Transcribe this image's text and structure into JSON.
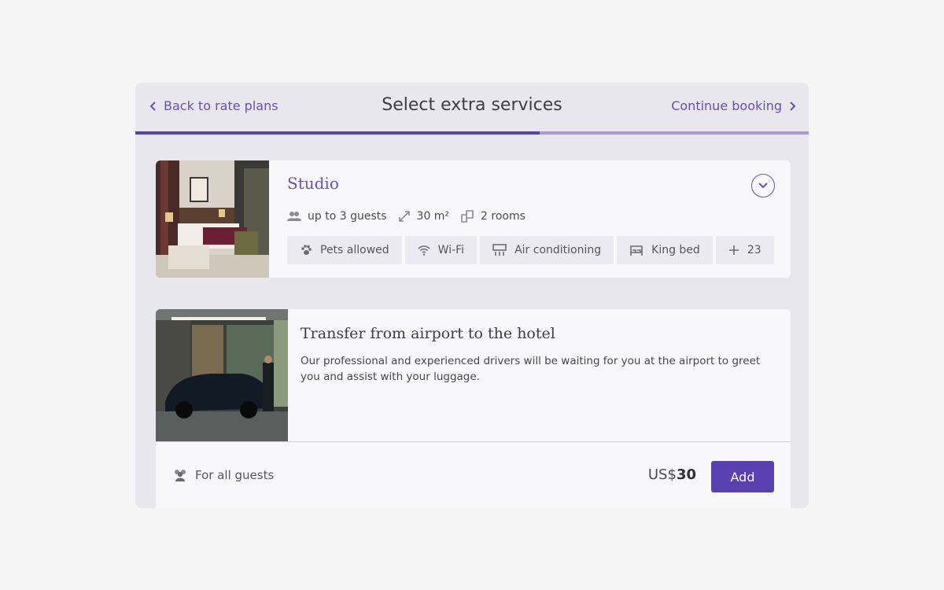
{
  "header": {
    "back_label": "Back to rate plans",
    "title": "Select extra services",
    "forward_label": "Continue booking",
    "progress_fraction": 0.6
  },
  "room": {
    "name": "Studio",
    "guests": "up to 3 guests",
    "area": "30 m²",
    "rooms": "2 rooms",
    "amenities": [
      {
        "icon": "paw-icon",
        "label": "Pets allowed"
      },
      {
        "icon": "wifi-icon",
        "label": "Wi-Fi"
      },
      {
        "icon": "air-conditioning-icon",
        "label": "Air conditioning"
      },
      {
        "icon": "bed-icon",
        "label": "King bed"
      },
      {
        "icon": "plus-icon",
        "label": "23"
      }
    ]
  },
  "service": {
    "title": "Transfer from airport to the hotel",
    "description": "Our professional and experienced drivers will be waiting for you at the airport to greet you and assist with your luggage.",
    "guests_label": "For all guests",
    "currency": "US$",
    "price": "30",
    "add_label": "Add"
  },
  "colors": {
    "accent": "#5a3fb0",
    "link": "#6a4fb3",
    "panel_bg": "#e8e7ee",
    "card_bg": "#f8f8fb"
  }
}
